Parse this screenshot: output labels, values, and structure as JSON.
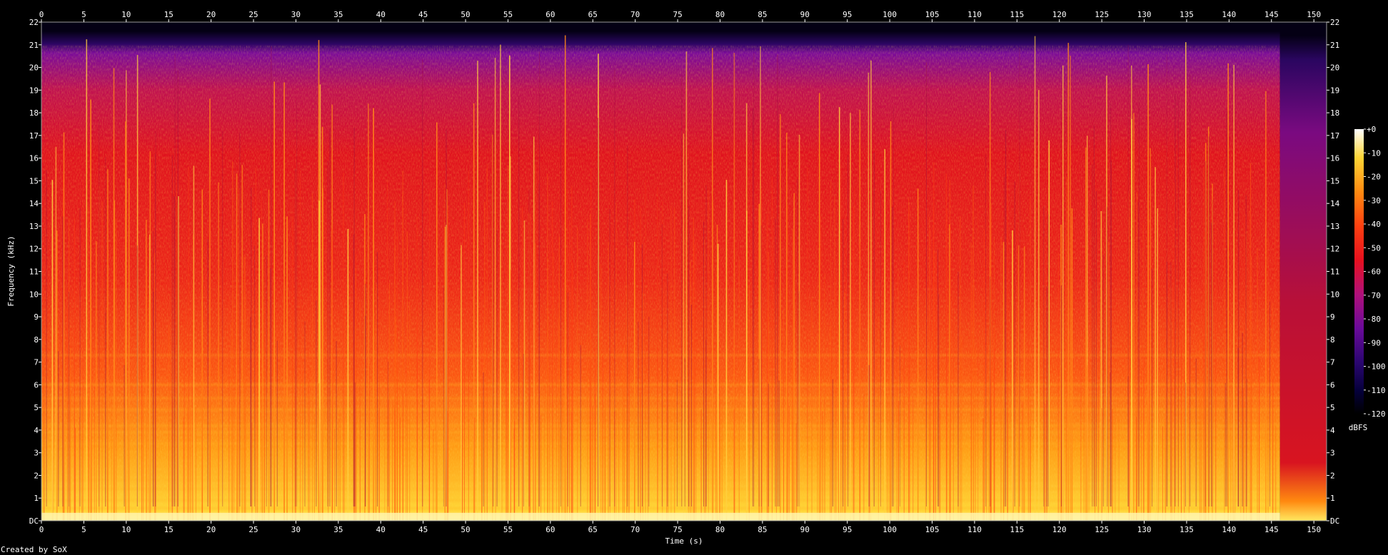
{
  "chart_data": {
    "type": "heatmap",
    "subtype": "spectrogram",
    "xlabel": "Time (s)",
    "ylabel": "Frequency (kHz)",
    "x_ticks": [
      0,
      5,
      10,
      15,
      20,
      25,
      30,
      35,
      40,
      45,
      50,
      55,
      60,
      65,
      70,
      75,
      80,
      85,
      90,
      95,
      100,
      105,
      110,
      115,
      120,
      125,
      130,
      135,
      140,
      145,
      150
    ],
    "y_tick_labels": [
      "DC",
      "1",
      "2",
      "3",
      "4",
      "5",
      "6",
      "7",
      "8",
      "9",
      "10",
      "11",
      "12",
      "13",
      "14",
      "15",
      "16",
      "17",
      "18",
      "19",
      "20",
      "21",
      "22"
    ],
    "xlim": [
      0,
      151.5
    ],
    "ylim": [
      0,
      22
    ],
    "colorbar": {
      "label": "dBFS",
      "ticks": [
        "+0",
        "-10",
        "-20",
        "-30",
        "-40",
        "-50",
        "-60",
        "-70",
        "-80",
        "-90",
        "-100",
        "-110",
        "-120"
      ],
      "range": [
        -120,
        0
      ]
    },
    "energy_cutoff_khz": 21.6,
    "track_end_s": 146,
    "colors": {
      "background": "#000000",
      "low": "#000014",
      "mid_low": "#7a0a9a",
      "mid": "#e8101e",
      "mid_high": "#ff7a00",
      "high": "#ffe23a",
      "peak": "#ffffff"
    }
  },
  "footer_text": "Created by SoX"
}
